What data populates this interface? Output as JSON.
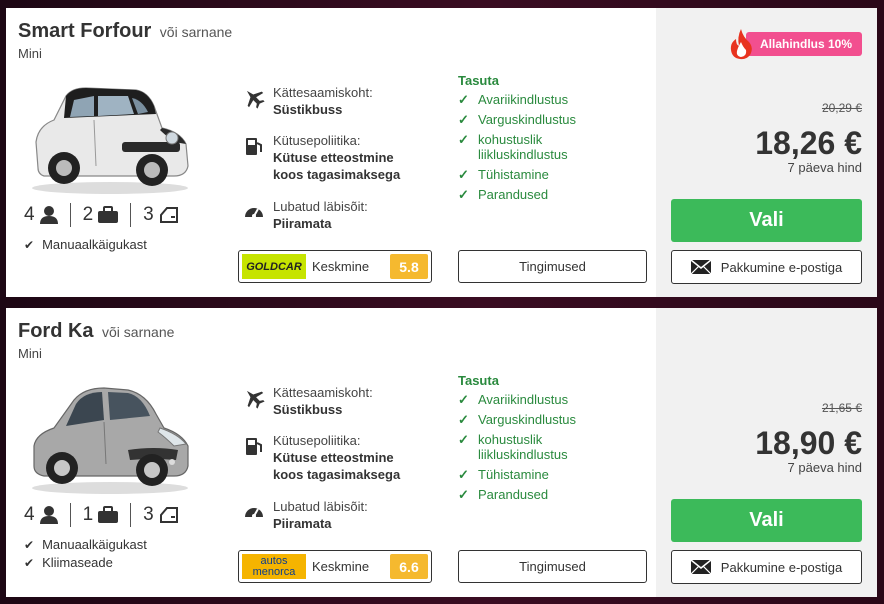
{
  "colors": {
    "accent_green": "#3cba5a",
    "included_green": "#2a8a3e",
    "discount_pink": "#f24f8f",
    "score_yellow": "#f5b92f"
  },
  "cars": [
    {
      "name": "Smart Forfour",
      "or_similar": "või sarnane",
      "category": "Mini",
      "passengers": "4",
      "bags": "2",
      "doors": "3",
      "features": [
        "Manuaalkäigukast"
      ],
      "pickup_label": "Kättesaamiskoht:",
      "pickup_value": "Süstikbuss",
      "fuel_label": "Kütusepoliitika:",
      "fuel_value_1": "Kütuse etteostmine",
      "fuel_value_2": "koos tagasimaksega",
      "mileage_label": "Lubatud läbisõit:",
      "mileage_value": "Piiramata",
      "included_title": "Tasuta",
      "included": [
        "Avariikindlustus",
        "Varguskindlustus",
        "kohustuslik",
        "liikluskindlustus",
        "Tühistamine",
        "Parandused"
      ],
      "supplier_logo": "GOLDCAR",
      "supplier_rating_label": "Keskmine",
      "supplier_score": "5.8",
      "terms_label": "Tingimused",
      "discount_label": "Allahindlus 10%",
      "old_price": "20,29 €",
      "price": "18,26 €",
      "price_note": "7 päeva hind",
      "select_label": "Vali",
      "email_label": "Pakkumine e-postiga"
    },
    {
      "name": "Ford Ka",
      "or_similar": "või sarnane",
      "category": "Mini",
      "passengers": "4",
      "bags": "1",
      "doors": "3",
      "features": [
        "Manuaalkäigukast",
        "Kliimaseade"
      ],
      "pickup_label": "Kättesaamiskoht:",
      "pickup_value": "Süstikbuss",
      "fuel_label": "Kütusepoliitika:",
      "fuel_value_1": "Kütuse etteostmine",
      "fuel_value_2": "koos tagasimaksega",
      "mileage_label": "Lubatud läbisõit:",
      "mileage_value": "Piiramata",
      "included_title": "Tasuta",
      "included": [
        "Avariikindlustus",
        "Varguskindlustus",
        "kohustuslik",
        "liikluskindlustus",
        "Tühistamine",
        "Parandused"
      ],
      "supplier_logo_1": "autos",
      "supplier_logo_2": "menorca",
      "supplier_rating_label": "Keskmine",
      "supplier_score": "6.6",
      "terms_label": "Tingimused",
      "old_price": "21,65 €",
      "price": "18,90 €",
      "price_note": "7 päeva hind",
      "select_label": "Vali",
      "email_label": "Pakkumine e-postiga"
    }
  ]
}
